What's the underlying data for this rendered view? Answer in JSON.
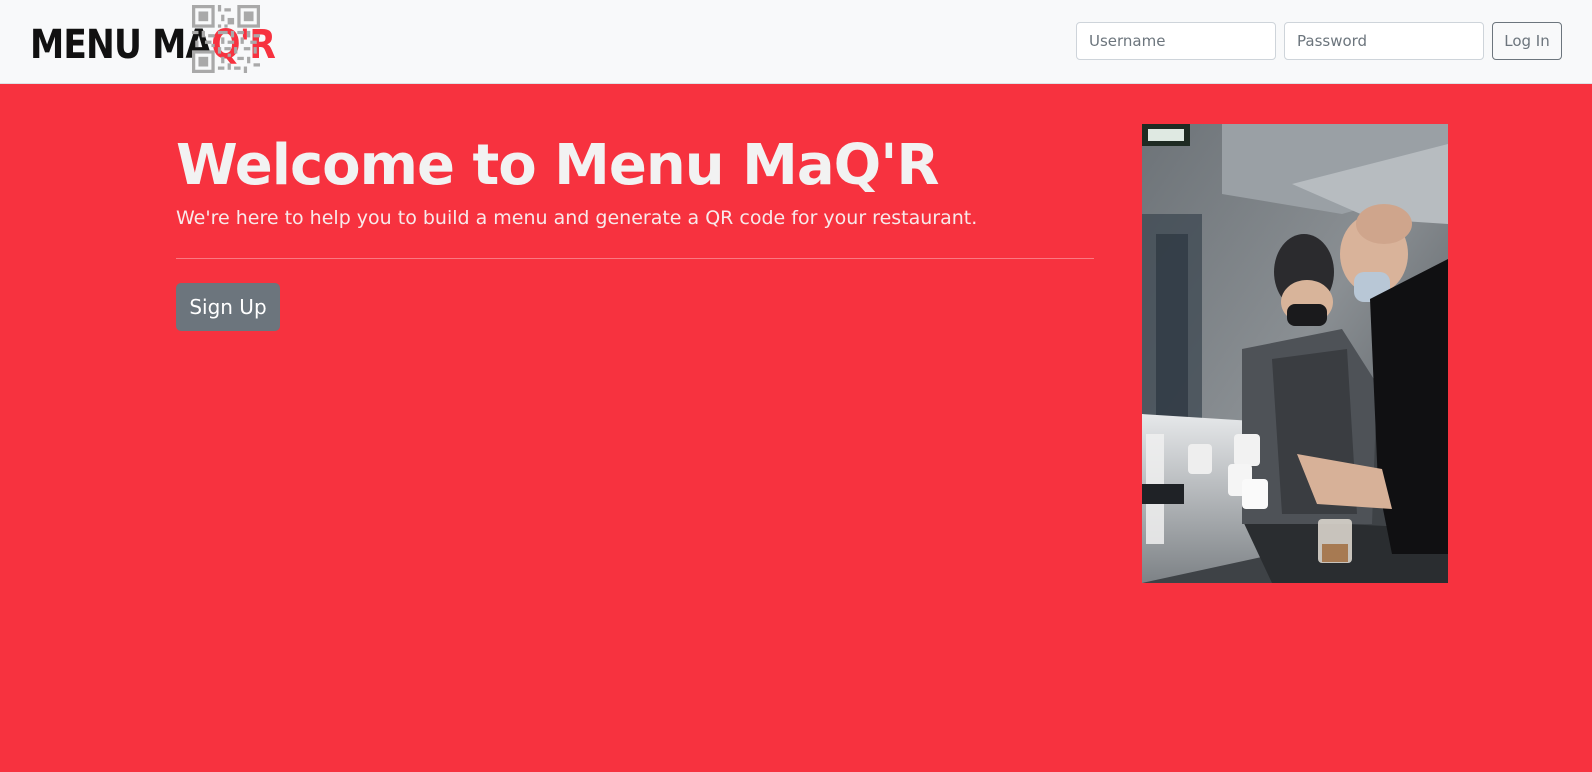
{
  "brand": {
    "logo_text_plain": "MENU MA",
    "logo_text_accent": "Q'R",
    "accent_color": "#f7323f"
  },
  "login": {
    "username_placeholder": "Username",
    "password_placeholder": "Password",
    "login_label": "Log In"
  },
  "hero": {
    "title": "Welcome to Menu MaQ'R",
    "lead": "We're here to help you to build a menu and generate a QR code for your restaurant.",
    "signup_label": "Sign Up"
  },
  "photo": {
    "subject": "kitchen-staff-photo"
  },
  "colors": {
    "background": "#f7323f",
    "navbar": "#f8f9fa",
    "secondary_button": "#6c757d"
  }
}
